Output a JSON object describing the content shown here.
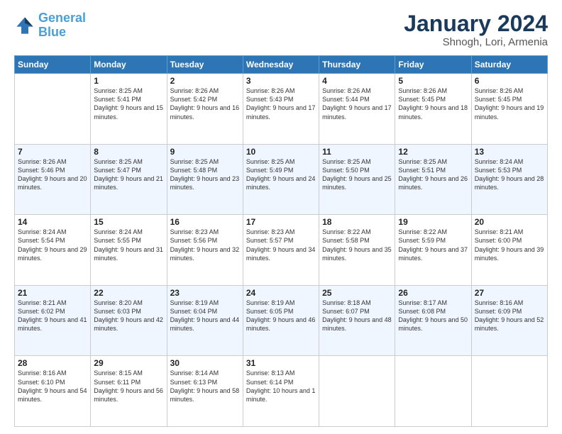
{
  "header": {
    "logo_line1": "General",
    "logo_line2": "Blue",
    "month_title": "January 2024",
    "subtitle": "Shnogh, Lori, Armenia"
  },
  "days_of_week": [
    "Sunday",
    "Monday",
    "Tuesday",
    "Wednesday",
    "Thursday",
    "Friday",
    "Saturday"
  ],
  "weeks": [
    [
      {
        "day": "",
        "sunrise": "",
        "sunset": "",
        "daylight": ""
      },
      {
        "day": "1",
        "sunrise": "Sunrise: 8:25 AM",
        "sunset": "Sunset: 5:41 PM",
        "daylight": "Daylight: 9 hours and 15 minutes."
      },
      {
        "day": "2",
        "sunrise": "Sunrise: 8:26 AM",
        "sunset": "Sunset: 5:42 PM",
        "daylight": "Daylight: 9 hours and 16 minutes."
      },
      {
        "day": "3",
        "sunrise": "Sunrise: 8:26 AM",
        "sunset": "Sunset: 5:43 PM",
        "daylight": "Daylight: 9 hours and 17 minutes."
      },
      {
        "day": "4",
        "sunrise": "Sunrise: 8:26 AM",
        "sunset": "Sunset: 5:44 PM",
        "daylight": "Daylight: 9 hours and 17 minutes."
      },
      {
        "day": "5",
        "sunrise": "Sunrise: 8:26 AM",
        "sunset": "Sunset: 5:45 PM",
        "daylight": "Daylight: 9 hours and 18 minutes."
      },
      {
        "day": "6",
        "sunrise": "Sunrise: 8:26 AM",
        "sunset": "Sunset: 5:45 PM",
        "daylight": "Daylight: 9 hours and 19 minutes."
      }
    ],
    [
      {
        "day": "7",
        "sunrise": "Sunrise: 8:26 AM",
        "sunset": "Sunset: 5:46 PM",
        "daylight": "Daylight: 9 hours and 20 minutes."
      },
      {
        "day": "8",
        "sunrise": "Sunrise: 8:25 AM",
        "sunset": "Sunset: 5:47 PM",
        "daylight": "Daylight: 9 hours and 21 minutes."
      },
      {
        "day": "9",
        "sunrise": "Sunrise: 8:25 AM",
        "sunset": "Sunset: 5:48 PM",
        "daylight": "Daylight: 9 hours and 23 minutes."
      },
      {
        "day": "10",
        "sunrise": "Sunrise: 8:25 AM",
        "sunset": "Sunset: 5:49 PM",
        "daylight": "Daylight: 9 hours and 24 minutes."
      },
      {
        "day": "11",
        "sunrise": "Sunrise: 8:25 AM",
        "sunset": "Sunset: 5:50 PM",
        "daylight": "Daylight: 9 hours and 25 minutes."
      },
      {
        "day": "12",
        "sunrise": "Sunrise: 8:25 AM",
        "sunset": "Sunset: 5:51 PM",
        "daylight": "Daylight: 9 hours and 26 minutes."
      },
      {
        "day": "13",
        "sunrise": "Sunrise: 8:24 AM",
        "sunset": "Sunset: 5:53 PM",
        "daylight": "Daylight: 9 hours and 28 minutes."
      }
    ],
    [
      {
        "day": "14",
        "sunrise": "Sunrise: 8:24 AM",
        "sunset": "Sunset: 5:54 PM",
        "daylight": "Daylight: 9 hours and 29 minutes."
      },
      {
        "day": "15",
        "sunrise": "Sunrise: 8:24 AM",
        "sunset": "Sunset: 5:55 PM",
        "daylight": "Daylight: 9 hours and 31 minutes."
      },
      {
        "day": "16",
        "sunrise": "Sunrise: 8:23 AM",
        "sunset": "Sunset: 5:56 PM",
        "daylight": "Daylight: 9 hours and 32 minutes."
      },
      {
        "day": "17",
        "sunrise": "Sunrise: 8:23 AM",
        "sunset": "Sunset: 5:57 PM",
        "daylight": "Daylight: 9 hours and 34 minutes."
      },
      {
        "day": "18",
        "sunrise": "Sunrise: 8:22 AM",
        "sunset": "Sunset: 5:58 PM",
        "daylight": "Daylight: 9 hours and 35 minutes."
      },
      {
        "day": "19",
        "sunrise": "Sunrise: 8:22 AM",
        "sunset": "Sunset: 5:59 PM",
        "daylight": "Daylight: 9 hours and 37 minutes."
      },
      {
        "day": "20",
        "sunrise": "Sunrise: 8:21 AM",
        "sunset": "Sunset: 6:00 PM",
        "daylight": "Daylight: 9 hours and 39 minutes."
      }
    ],
    [
      {
        "day": "21",
        "sunrise": "Sunrise: 8:21 AM",
        "sunset": "Sunset: 6:02 PM",
        "daylight": "Daylight: 9 hours and 41 minutes."
      },
      {
        "day": "22",
        "sunrise": "Sunrise: 8:20 AM",
        "sunset": "Sunset: 6:03 PM",
        "daylight": "Daylight: 9 hours and 42 minutes."
      },
      {
        "day": "23",
        "sunrise": "Sunrise: 8:19 AM",
        "sunset": "Sunset: 6:04 PM",
        "daylight": "Daylight: 9 hours and 44 minutes."
      },
      {
        "day": "24",
        "sunrise": "Sunrise: 8:19 AM",
        "sunset": "Sunset: 6:05 PM",
        "daylight": "Daylight: 9 hours and 46 minutes."
      },
      {
        "day": "25",
        "sunrise": "Sunrise: 8:18 AM",
        "sunset": "Sunset: 6:07 PM",
        "daylight": "Daylight: 9 hours and 48 minutes."
      },
      {
        "day": "26",
        "sunrise": "Sunrise: 8:17 AM",
        "sunset": "Sunset: 6:08 PM",
        "daylight": "Daylight: 9 hours and 50 minutes."
      },
      {
        "day": "27",
        "sunrise": "Sunrise: 8:16 AM",
        "sunset": "Sunset: 6:09 PM",
        "daylight": "Daylight: 9 hours and 52 minutes."
      }
    ],
    [
      {
        "day": "28",
        "sunrise": "Sunrise: 8:16 AM",
        "sunset": "Sunset: 6:10 PM",
        "daylight": "Daylight: 9 hours and 54 minutes."
      },
      {
        "day": "29",
        "sunrise": "Sunrise: 8:15 AM",
        "sunset": "Sunset: 6:11 PM",
        "daylight": "Daylight: 9 hours and 56 minutes."
      },
      {
        "day": "30",
        "sunrise": "Sunrise: 8:14 AM",
        "sunset": "Sunset: 6:13 PM",
        "daylight": "Daylight: 9 hours and 58 minutes."
      },
      {
        "day": "31",
        "sunrise": "Sunrise: 8:13 AM",
        "sunset": "Sunset: 6:14 PM",
        "daylight": "Daylight: 10 hours and 1 minute."
      },
      {
        "day": "",
        "sunrise": "",
        "sunset": "",
        "daylight": ""
      },
      {
        "day": "",
        "sunrise": "",
        "sunset": "",
        "daylight": ""
      },
      {
        "day": "",
        "sunrise": "",
        "sunset": "",
        "daylight": ""
      }
    ]
  ]
}
